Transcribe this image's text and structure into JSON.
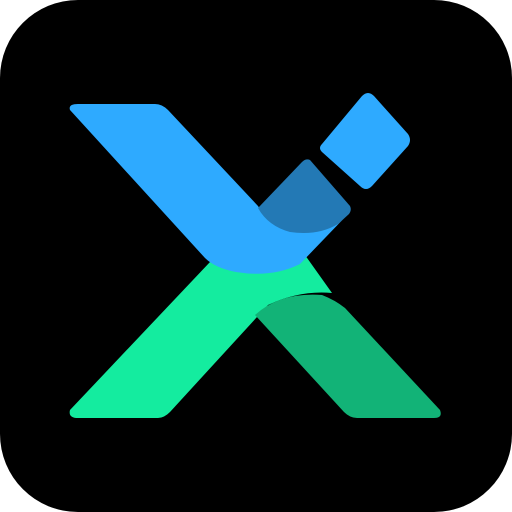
{
  "icon": {
    "name": "x-logo-app-icon",
    "colors": {
      "tile_background": "#000000",
      "page_background": "#ffffff",
      "blue_light": "#2eaaff",
      "blue_dark": "#2379b5",
      "green_light": "#14ec9f",
      "green_dark": "#12b377"
    }
  }
}
